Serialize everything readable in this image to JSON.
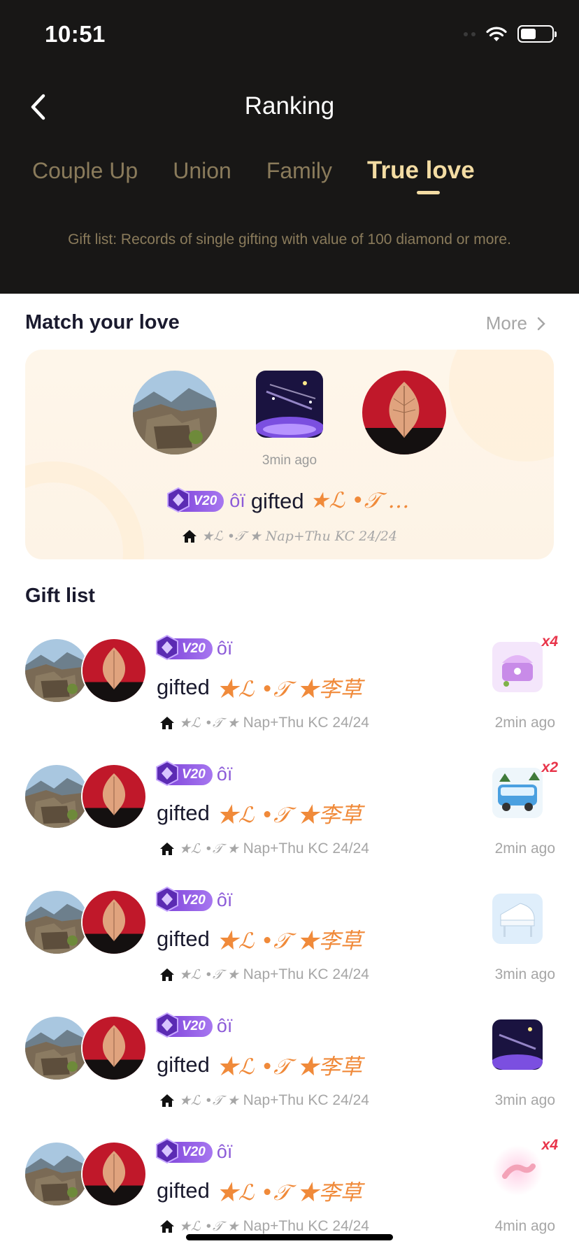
{
  "status_bar": {
    "time": "10:51"
  },
  "nav": {
    "title": "Ranking"
  },
  "tabs": [
    {
      "label": "Couple Up",
      "active": false
    },
    {
      "label": "Union",
      "active": false
    },
    {
      "label": "Family",
      "active": false
    },
    {
      "label": "True love",
      "active": true
    }
  ],
  "header_note": "Gift list: Records of single gifting with value of 100 diamond or more.",
  "match_section": {
    "title": "Match your love",
    "more_label": "More",
    "time": "3min ago",
    "vip_level": "V20",
    "sender_name": "ôï",
    "action": "gifted",
    "receiver_name": "★ℒ •𝒯 …",
    "sub_name": "★ℒ •𝒯 ★ Nap+Thu KC 24/24"
  },
  "gift_list_title": "Gift list",
  "gift_rows": [
    {
      "vip": "V20",
      "sender": "ôï",
      "action": "gifted",
      "receiver": "★ℒ •𝒯 ★李草",
      "sub_prefix": "★ℒ •𝒯 ★",
      "sub_text": "Nap+Thu KC 24/24",
      "qty": "x4",
      "time": "2min ago",
      "gift_icon": "jewelry-box-icon"
    },
    {
      "vip": "V20",
      "sender": "ôï",
      "action": "gifted",
      "receiver": "★ℒ •𝒯 ★李草",
      "sub_prefix": "★ℒ •𝒯 ★",
      "sub_text": "Nap+Thu KC 24/24",
      "qty": "x2",
      "time": "2min ago",
      "gift_icon": "camper-van-icon"
    },
    {
      "vip": "V20",
      "sender": "ôï",
      "action": "gifted",
      "receiver": "★ℒ •𝒯 ★李草",
      "sub_prefix": "★ℒ •𝒯 ★",
      "sub_text": "Nap+Thu KC 24/24",
      "qty": "",
      "time": "3min ago",
      "gift_icon": "piano-icon"
    },
    {
      "vip": "V20",
      "sender": "ôï",
      "action": "gifted",
      "receiver": "★ℒ •𝒯 ★李草",
      "sub_prefix": "★ℒ •𝒯 ★",
      "sub_text": "Nap+Thu KC 24/24",
      "qty": "",
      "time": "3min ago",
      "gift_icon": "galaxy-icon"
    },
    {
      "vip": "V20",
      "sender": "ôï",
      "action": "gifted",
      "receiver": "★ℒ •𝒯 ★李草",
      "sub_prefix": "★ℒ •𝒯 ★",
      "sub_text": "Nap+Thu KC 24/24",
      "qty": "x4",
      "time": "4min ago",
      "gift_icon": "hands-icon"
    }
  ],
  "colors": {
    "header_bg": "#181716",
    "tab_active": "#f3dca3",
    "tab_inactive": "#8a7b5b",
    "accent_orange": "#f08a3a",
    "vip_purple": "#8c5bd8",
    "qty_red": "#e8344a"
  }
}
